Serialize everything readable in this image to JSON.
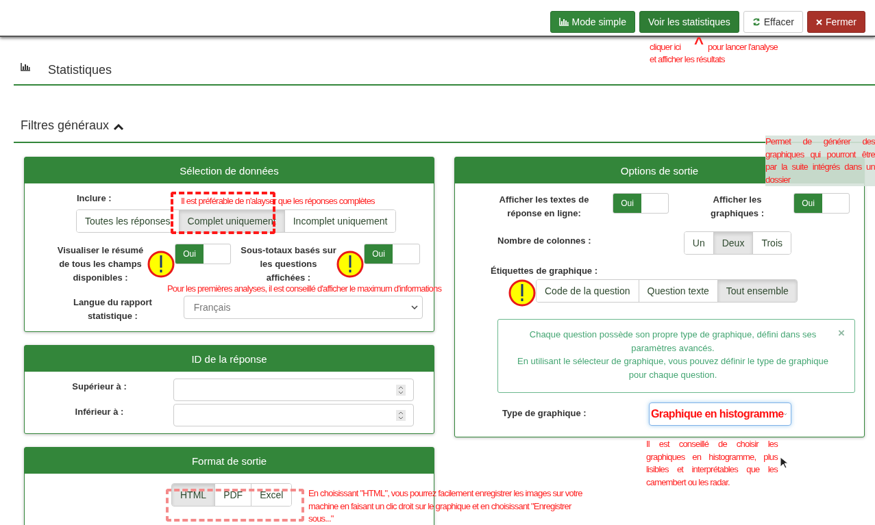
{
  "toolbar": {
    "buttons": [
      {
        "label": "Mode simple",
        "kind": "chart"
      },
      {
        "label": "Voir les statistiques",
        "kind": "primary"
      },
      {
        "label": "Effacer",
        "kind": "refresh"
      },
      {
        "label": "Fermer",
        "kind": "close"
      }
    ]
  },
  "section": {
    "title": "Statistiques"
  },
  "filters": {
    "title": "Filtres généraux",
    "expanded": true
  },
  "data_selection": {
    "title": "Sélection de données",
    "include_label": "Inclure :",
    "include_options": [
      {
        "label": "Toutes les réponses",
        "selected": false
      },
      {
        "label": "Complet uniquement",
        "selected": true
      },
      {
        "label": "Incomplet uniquement",
        "selected": false
      }
    ],
    "toggles": [
      {
        "label": "Visualiser le résumé de tous les champs disponibles :",
        "on": true,
        "on_label": "Oui"
      },
      {
        "label": "Sous-totaux basés sur les questions affichées :",
        "on": true,
        "on_label": "Oui"
      }
    ],
    "language_label": "Langue du rapport statistique :",
    "language_value": "Français"
  },
  "response_id": {
    "title": "ID de la réponse",
    "fields": [
      {
        "label": "Supérieur à :"
      },
      {
        "label": "Inférieur à :"
      }
    ]
  },
  "output_format": {
    "title": "Format de sortie",
    "options": [
      {
        "label": "HTML",
        "selected": true
      },
      {
        "label": "PDF",
        "selected": false
      },
      {
        "label": "Excel",
        "selected": false
      }
    ]
  },
  "output_options": {
    "title": "Options de sortie",
    "toggles": [
      {
        "label": "Afficher les textes de réponse en ligne:",
        "on": true,
        "on_label": "Oui"
      },
      {
        "label": "Afficher les graphiques :",
        "on": true,
        "on_label": "Oui"
      }
    ],
    "columns_label": "Nombre de colonnes :",
    "columns_options": [
      {
        "label": "Un",
        "selected": false
      },
      {
        "label": "Deux",
        "selected": true
      },
      {
        "label": "Trois",
        "selected": false
      }
    ],
    "labels_label": "Étiquettes de graphique :",
    "labels_options": [
      {
        "label": "Code de la question",
        "selected": false
      },
      {
        "label": "Question texte",
        "selected": false
      },
      {
        "label": "Tout ensemble",
        "selected": true
      }
    ],
    "alert": {
      "lines": [
        "Chaque question possède son propre type de graphique, défini dans ses paramètres avancés.",
        "En utilisant le sélecteur de graphique, vous pouvez définir le type de graphique pour chaque question."
      ],
      "close": "×"
    },
    "chart_type_label": "Type de graphique :",
    "chart_type_value": "Graphique en histogramme"
  },
  "annotations": [
    {
      "kind": "inline",
      "text": "cliquer ici"
    },
    {
      "kind": "caret",
      "text": "^"
    },
    {
      "kind": "inline",
      "text": "pour lancer l'analyse"
    },
    {
      "kind": "inline",
      "text": "et afficher les résultats"
    },
    {
      "kind": "note",
      "text": "Permet de générer des graphiques qui pourront être par la suite intégrés dans un dossier"
    },
    {
      "kind": "inline",
      "text": "Il est préférable de n'alayser que les réponses complètes"
    },
    {
      "kind": "inline",
      "text": "Pour les premières analyses, il est conseillé d'afficher le maximum d'informations"
    },
    {
      "kind": "justified",
      "text": "Il est conseillé de choisir les graphiques en histogramme, plus lisibles et interprétables que les camembert ou les radar."
    },
    {
      "kind": "block",
      "text": "En choisissant \"HTML\", vous pourrez facilement enregistrer les images sur votre machine en faisant un clic droit sur le graphique et en choisissant \"Enregistrer sous...\""
    }
  ]
}
